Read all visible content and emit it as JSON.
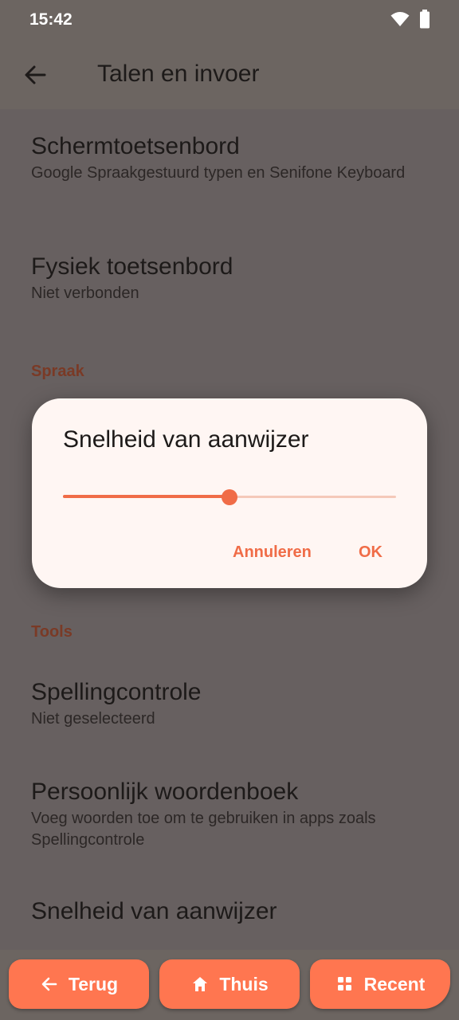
{
  "status_bar": {
    "time": "15:42"
  },
  "app_bar": {
    "title": "Talen en invoer"
  },
  "list": {
    "items": [
      {
        "title": "Schermtoetsenbord",
        "summary": "Google Spraakgestuurd typen en Senifone Keyboard"
      },
      {
        "title": "Fysiek toetsenbord",
        "summary": "Niet verbonden"
      }
    ],
    "section_speech": "Spraak",
    "section_tools": "Tools",
    "tools_items": [
      {
        "title": "Spellingcontrole",
        "summary": "Niet geselecteerd"
      },
      {
        "title": "Persoonlijk woordenboek",
        "summary": "Voeg woorden toe om te gebruiken in apps zoals Spellingcontrole"
      },
      {
        "title": "Snelheid van aanwijzer"
      }
    ]
  },
  "dialog": {
    "title": "Snelheid van aanwijzer",
    "slider_value": 0.5,
    "cancel_label": "Annuleren",
    "ok_label": "OK"
  },
  "nav": {
    "back_label": "Terug",
    "home_label": "Thuis",
    "recent_label": "Recent"
  },
  "colors": {
    "accent": "#f06c47",
    "nav_button": "#ff7650",
    "section_header": "#7a3a26"
  }
}
